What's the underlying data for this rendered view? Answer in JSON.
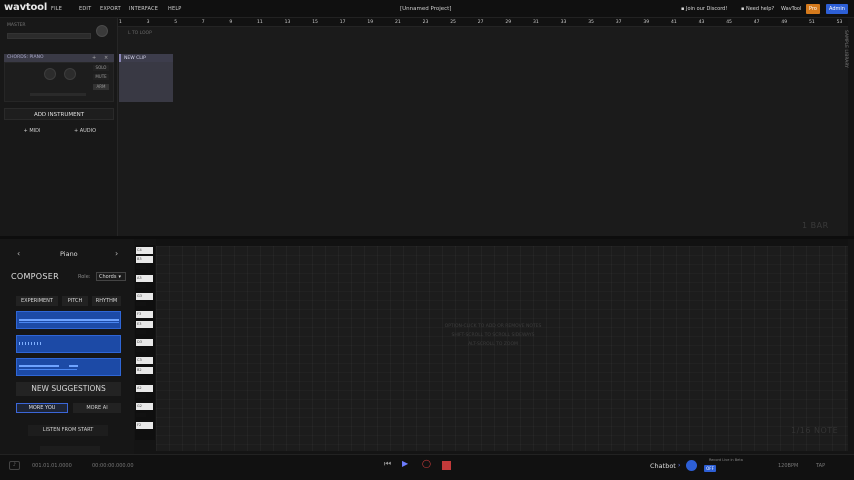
{
  "app": {
    "logo": "wavtool",
    "menu": [
      "FILE",
      "EDIT",
      "EXPORT",
      "INTERFACE",
      "HELP"
    ],
    "project_title": "[Unnamed Project]",
    "links": {
      "discord": "Join our Discord!",
      "help": "Need help?",
      "brand": "WavTool"
    },
    "pro_badge": "Pro",
    "admin": "Admin"
  },
  "tracks": {
    "master_label": "MASTER",
    "track_name": "CHORDS: PIANO",
    "solo": "SOLO",
    "mute": "MUTE",
    "arm": "ARM",
    "add_instrument": "ADD INSTRUMENT",
    "add_midi": "+ MIDI",
    "add_audio": "+ AUDIO"
  },
  "arrangement": {
    "ruler": [
      "1",
      "3",
      "5",
      "7",
      "9",
      "11",
      "13",
      "15",
      "17",
      "19",
      "21",
      "23",
      "25",
      "27",
      "29",
      "31",
      "33",
      "35",
      "37",
      "39",
      "41",
      "43",
      "45",
      "47",
      "49",
      "51",
      "53"
    ],
    "loop_label": "L TO LOOP",
    "clip_name": "NEW CLIP",
    "bar_label": "1 BAR",
    "side_tab": "SAMPLE LIBRARY"
  },
  "composer": {
    "instrument": "Piano",
    "title": "COMPOSER",
    "role_label": "Role:",
    "role_value": "Chords",
    "tabs": [
      "EXPERIMENT",
      "PITCH",
      "RHYTHM"
    ],
    "new_suggestions": "NEW SUGGESTIONS",
    "more_you": "MORE YOU",
    "more_ai": "MORE AI",
    "listen": "LISTEN FROM START"
  },
  "piano_roll": {
    "keys": [
      "C4",
      "B3",
      "A#3",
      "A3",
      "G#3",
      "G3",
      "F#3",
      "F3",
      "E3",
      "D#3",
      "D3",
      "C#3",
      "C3",
      "B2",
      "A#2",
      "A2",
      "G#2",
      "G2",
      "F#2",
      "F2"
    ],
    "hints": [
      "OPTION-CLICK TO ADD OR REMOVE NOTES",
      "SHIFT-SCROLL TO SCROLL SIDEWAYS",
      "ALT-SCROLL TO ZOOM"
    ],
    "note_label": "1/16 NOTE"
  },
  "transport": {
    "position": "001.01.01.0000",
    "time": "00:00:00.000.00",
    "chatbot": "Chatbot",
    "chat_badge": "OFF",
    "record_note": "Record Live in Beta",
    "bpm": "120BPM",
    "tap": "TAP"
  }
}
